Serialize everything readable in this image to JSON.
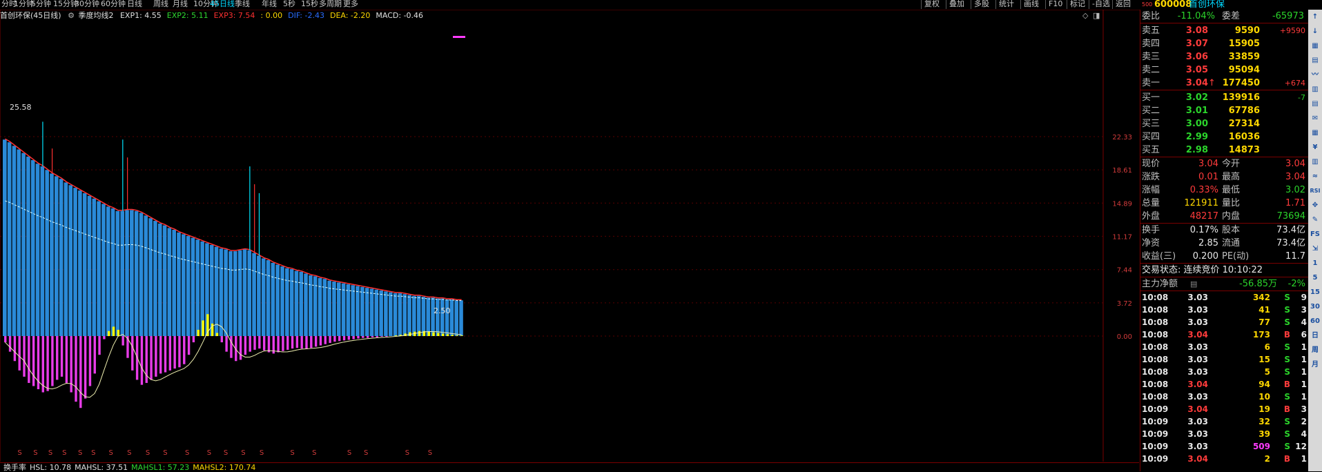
{
  "toolbar": {
    "periods": [
      "分时",
      "1分钟",
      "5分钟",
      "15分钟",
      "30分钟",
      "60分钟",
      "日线",
      "周线",
      "月线",
      "10分钟",
      "45日线",
      "季线",
      "年线",
      "5秒",
      "15秒",
      "多周期",
      "更多"
    ],
    "active_period": "45日线",
    "right_buttons": [
      "复权",
      "叠加",
      "多股",
      "统计",
      "画线",
      "F10",
      "标记",
      "-自选",
      "返回"
    ]
  },
  "indicator_line": {
    "title": "首创环保(45日线)",
    "gear_icon": "gear-icon",
    "formula": "季度均线2",
    "items": [
      {
        "text": "EXP1: 4.55",
        "color": "#e0e0e0"
      },
      {
        "text": "EXP2: 5.11",
        "color": "#30d830"
      },
      {
        "text": "EXP3: 7.54",
        "color": "#ff3030"
      },
      {
        "text": ": 0.00",
        "color": "#ffd800"
      },
      {
        "text": "DIF: -2.43",
        "color": "#2a6cff"
      },
      {
        "text": "DEA: -2.20",
        "color": "#ffd800"
      },
      {
        "text": "MACD: -0.46",
        "color": "#e0e0e0"
      }
    ]
  },
  "chart_data": {
    "type": "bar",
    "y_ticks": [
      "22.33",
      "18.61",
      "14.89",
      "11.17",
      "7.44",
      "3.72",
      "0.00"
    ],
    "y_tick_values": [
      22.33,
      18.61,
      14.89,
      11.17,
      7.44,
      3.72,
      0.0
    ],
    "ylim": [
      -13.0,
      25.58
    ],
    "max_label": "25.58",
    "min_label": "2.50",
    "band_values": [
      22.0,
      21.7,
      21.3,
      20.9,
      20.5,
      20.1,
      19.7,
      19.3,
      19.0,
      18.6,
      18.2,
      17.9,
      17.6,
      17.2,
      16.9,
      16.6,
      16.3,
      16.0,
      15.7,
      15.4,
      15.1,
      14.8,
      14.5,
      14.3,
      14.0,
      14.0,
      14.1,
      14.1,
      14.0,
      13.8,
      13.5,
      13.2,
      12.9,
      12.6,
      12.4,
      12.1,
      11.9,
      11.6,
      11.4,
      11.2,
      11.0,
      10.8,
      10.6,
      10.4,
      10.2,
      10.0,
      9.8,
      9.7,
      9.5,
      9.5,
      9.6,
      9.7,
      9.6,
      9.3,
      9.0,
      8.7,
      8.5,
      8.2,
      8.0,
      7.8,
      7.6,
      7.5,
      7.3,
      7.2,
      7.0,
      6.8,
      6.7,
      6.5,
      6.4,
      6.2,
      6.1,
      6.0,
      5.9,
      5.8,
      5.7,
      5.6,
      5.5,
      5.4,
      5.3,
      5.2,
      5.1,
      5.0,
      4.9,
      4.8,
      4.8,
      4.7,
      4.6,
      4.5,
      4.5,
      4.4,
      4.3,
      4.3,
      4.2,
      4.2,
      4.1,
      4.1,
      4.0,
      4.0
    ],
    "macd_values": [
      -1.0,
      -2.5,
      -4.0,
      -5.5,
      -6.5,
      -7.5,
      -8.0,
      -8.5,
      -9.0,
      -8.8,
      -8.0,
      -7.0,
      -6.5,
      -7.5,
      -9.0,
      -10.5,
      -11.5,
      -10.0,
      -8.0,
      -6.0,
      -3.0,
      -0.5,
      0.8,
      1.5,
      1.0,
      -1.5,
      -3.5,
      -5.5,
      -7.0,
      -7.8,
      -7.5,
      -7.0,
      -6.5,
      -6.0,
      -5.8,
      -5.5,
      -5.2,
      -5.0,
      -4.5,
      -3.0,
      -1.0,
      1.0,
      2.5,
      3.5,
      2.0,
      0.5,
      -1.0,
      -2.5,
      -3.5,
      -4.0,
      -3.8,
      -3.0,
      -2.5,
      -2.2,
      -2.0,
      -2.3,
      -2.6,
      -2.8,
      -2.6,
      -2.4,
      -2.2,
      -2.0,
      -1.9,
      -2.0,
      -2.1,
      -1.9,
      -1.7,
      -1.5,
      -1.3,
      -1.1,
      -0.9,
      -0.8,
      -0.7,
      -0.6,
      -0.5,
      -0.4,
      -0.3,
      -0.3,
      -0.2,
      -0.2,
      -0.1,
      -0.1,
      0.0,
      0.1,
      0.2,
      0.4,
      0.6,
      0.7,
      0.8,
      0.8,
      0.7,
      0.6,
      0.5,
      0.4,
      0.3,
      0.2,
      0.1,
      0.1
    ],
    "markers_s": [
      "S",
      "S",
      "S",
      "S",
      "S",
      "S",
      "S",
      "S",
      "S",
      "S",
      "S",
      "S",
      "S",
      "S",
      "S",
      "S",
      "S",
      "S",
      "S",
      "S",
      "S"
    ],
    "legend_bottom": [
      {
        "text": "换手率",
        "color": "#e0e0e0"
      },
      {
        "text": "HSL: 10.78",
        "color": "#e0e0e0"
      },
      {
        "text": "MAHSL: 37.51",
        "color": "#e0e0e0"
      },
      {
        "text": "MAHSL1: 57.23",
        "color": "#30d830"
      },
      {
        "text": "MAHSL2: 170.74",
        "color": "#ffd800"
      }
    ]
  },
  "quote": {
    "code": "600008",
    "name": "首创环保",
    "badge": "500",
    "weibi_label": "委比",
    "weibi": "-11.04%",
    "weicha_label": "委差",
    "weicha": "-65973",
    "asks": [
      {
        "label": "卖五",
        "price": "3.08",
        "vol": "9590",
        "chg": "+9590"
      },
      {
        "label": "卖四",
        "price": "3.07",
        "vol": "15905",
        "chg": ""
      },
      {
        "label": "卖三",
        "price": "3.06",
        "vol": "33859",
        "chg": ""
      },
      {
        "label": "卖二",
        "price": "3.05",
        "vol": "95094",
        "chg": ""
      },
      {
        "label": "卖一",
        "price": "3.04",
        "vol": "177450",
        "chg": "+674"
      }
    ],
    "bids": [
      {
        "label": "买一",
        "price": "3.02",
        "vol": "139916",
        "chg": "-7"
      },
      {
        "label": "买二",
        "price": "3.01",
        "vol": "67786",
        "chg": ""
      },
      {
        "label": "买三",
        "price": "3.00",
        "vol": "27314",
        "chg": ""
      },
      {
        "label": "买四",
        "price": "2.99",
        "vol": "16036",
        "chg": ""
      },
      {
        "label": "买五",
        "price": "2.98",
        "vol": "14873",
        "chg": ""
      }
    ],
    "stats": [
      {
        "l1": "现价",
        "v1": "3.04",
        "c1": "red",
        "l2": "今开",
        "v2": "3.04",
        "c2": "red"
      },
      {
        "l1": "涨跌",
        "v1": "0.01",
        "c1": "red",
        "l2": "最高",
        "v2": "3.04",
        "c2": "red"
      },
      {
        "l1": "涨幅",
        "v1": "0.33%",
        "c1": "red",
        "l2": "最低",
        "v2": "3.02",
        "c2": "green"
      },
      {
        "l1": "总量",
        "v1": "121911",
        "c1": "yellow",
        "l2": "量比",
        "v2": "1.71",
        "c2": "red"
      },
      {
        "l1": "外盘",
        "v1": "48217",
        "c1": "red",
        "l2": "内盘",
        "v2": "73694",
        "c2": "green"
      }
    ],
    "stats2": [
      {
        "l1": "换手",
        "v1": "0.17%",
        "l2": "股本",
        "v2": "73.4亿"
      },
      {
        "l1": "净资",
        "v1": "2.85",
        "l2": "流通",
        "v2": "73.4亿"
      },
      {
        "l1": "收益(三)",
        "v1": "0.200",
        "l2": "PE(动)",
        "v2": "11.7"
      }
    ],
    "trade_status": "交易状态: 连续竞价 10:10:22",
    "main_net_label": "主力净额",
    "main_net_value": "-56.85万",
    "main_net_pct": "-2%",
    "ticks": [
      {
        "t": "10:08",
        "p": "3.03",
        "v": "342",
        "s": "S",
        "n": "9",
        "pc": "white",
        "vc": "yellow",
        "sc": "green"
      },
      {
        "t": "10:08",
        "p": "3.03",
        "v": "41",
        "s": "S",
        "n": "3",
        "pc": "white",
        "vc": "yellow",
        "sc": "green"
      },
      {
        "t": "10:08",
        "p": "3.03",
        "v": "77",
        "s": "S",
        "n": "4",
        "pc": "white",
        "vc": "yellow",
        "sc": "green"
      },
      {
        "t": "10:08",
        "p": "3.04",
        "v": "173",
        "s": "B",
        "n": "6",
        "pc": "red",
        "vc": "yellow",
        "sc": "red"
      },
      {
        "t": "10:08",
        "p": "3.03",
        "v": "6",
        "s": "S",
        "n": "1",
        "pc": "white",
        "vc": "yellow",
        "sc": "green"
      },
      {
        "t": "10:08",
        "p": "3.03",
        "v": "15",
        "s": "S",
        "n": "1",
        "pc": "white",
        "vc": "yellow",
        "sc": "green"
      },
      {
        "t": "10:08",
        "p": "3.03",
        "v": "5",
        "s": "S",
        "n": "1",
        "pc": "white",
        "vc": "yellow",
        "sc": "green"
      },
      {
        "t": "10:08",
        "p": "3.04",
        "v": "94",
        "s": "B",
        "n": "1",
        "pc": "red",
        "vc": "yellow",
        "sc": "red"
      },
      {
        "t": "10:08",
        "p": "3.03",
        "v": "10",
        "s": "S",
        "n": "1",
        "pc": "white",
        "vc": "yellow",
        "sc": "green"
      },
      {
        "t": "10:09",
        "p": "3.04",
        "v": "19",
        "s": "B",
        "n": "3",
        "pc": "red",
        "vc": "yellow",
        "sc": "red"
      },
      {
        "t": "10:09",
        "p": "3.03",
        "v": "32",
        "s": "S",
        "n": "2",
        "pc": "white",
        "vc": "yellow",
        "sc": "green"
      },
      {
        "t": "10:09",
        "p": "3.03",
        "v": "39",
        "s": "S",
        "n": "4",
        "pc": "white",
        "vc": "yellow",
        "sc": "green"
      },
      {
        "t": "10:09",
        "p": "3.03",
        "v": "509",
        "s": "S",
        "n": "12",
        "pc": "white",
        "vc": "magenta",
        "sc": "green"
      },
      {
        "t": "10:09",
        "p": "3.04",
        "v": "2",
        "s": "B",
        "n": "1",
        "pc": "red",
        "vc": "yellow",
        "sc": "red"
      }
    ]
  },
  "sidebar_icons": [
    "scroll-up-icon",
    "scroll-down-icon",
    "chart-icon",
    "grid-icon",
    "line-icon",
    "candle-icon",
    "list-icon",
    "news-icon",
    "table-icon",
    "money-icon",
    "chart2-icon",
    "wave-icon",
    "rsi-icon",
    "move-icon",
    "pen-icon",
    "fs-icon",
    "export-icon",
    "num-1",
    "num-5",
    "num-15",
    "num-30",
    "num-60",
    "day-label",
    "week-label",
    "month-label"
  ],
  "sidebar_labels": [
    "↑",
    "↓",
    "▦",
    "▤",
    "〰",
    "▥",
    "▤",
    "✉",
    "▦",
    "¥",
    "▥",
    "≈",
    "RSI",
    "✥",
    "✎",
    "FS",
    "⇲",
    "1",
    "5",
    "15",
    "30",
    "60",
    "日",
    "周",
    "月"
  ]
}
